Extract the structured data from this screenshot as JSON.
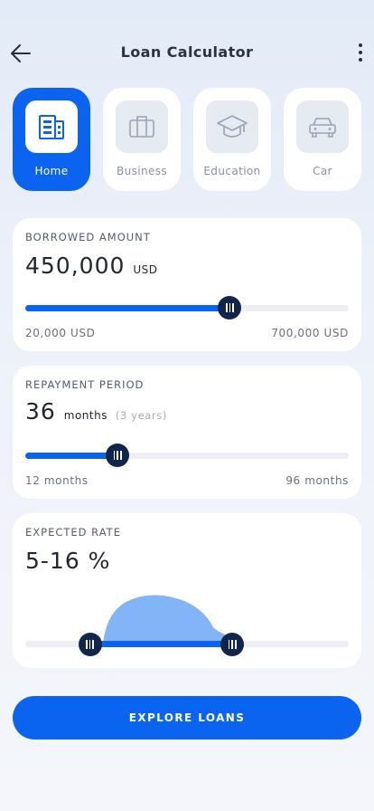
{
  "header": {
    "title": "Loan Calculator"
  },
  "categories": [
    {
      "label": "Home",
      "icon": "building-icon",
      "active": true
    },
    {
      "label": "Business",
      "icon": "briefcase-icon",
      "active": false
    },
    {
      "label": "Education",
      "icon": "graduation-cap-icon",
      "active": false
    },
    {
      "label": "Car",
      "icon": "car-icon",
      "active": false
    }
  ],
  "borrowed": {
    "label": "BORROWED AMOUNT",
    "value": "450,000",
    "unit": "USD",
    "min_label": "20,000 USD",
    "max_label": "700,000 USD",
    "min": 20000,
    "max": 700000,
    "current": 450000
  },
  "period": {
    "label": "REPAYMENT PERIOD",
    "value": "36",
    "unit": "months",
    "note": "(3 years)",
    "min_label": "12 months",
    "max_label": "96 months",
    "min": 12,
    "max": 96,
    "current": 36
  },
  "rate": {
    "label": "EXPECTED RATE",
    "value": "5-16 %",
    "low": 5,
    "high": 16
  },
  "cta": {
    "label": "EXPLORE LOANS"
  },
  "colors": {
    "accent": "#0a64f0",
    "thumb": "#11254a",
    "distribution": "#82b4f7"
  }
}
